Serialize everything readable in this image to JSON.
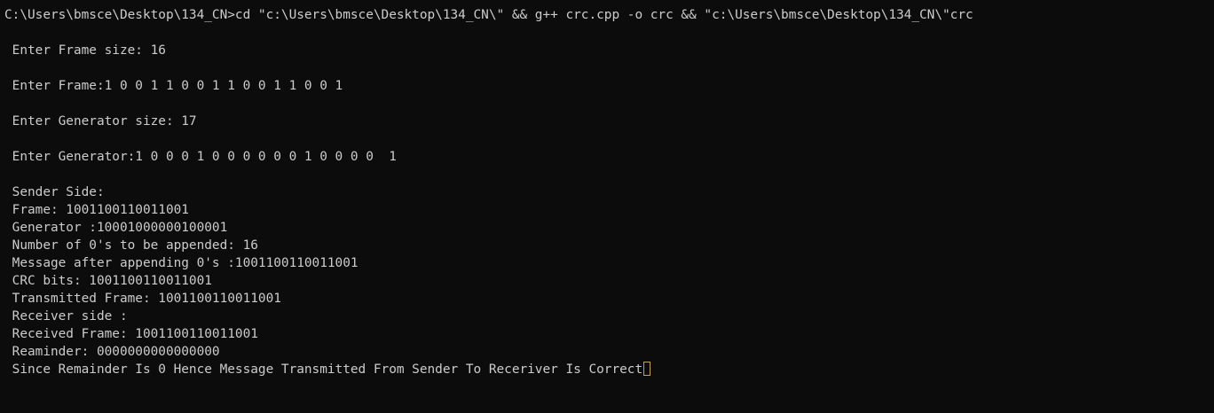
{
  "terminal": {
    "command_line": "C:\\Users\\bmsce\\Desktop\\134_CN>cd \"c:\\Users\\bmsce\\Desktop\\134_CN\\\" && g++ crc.cpp -o crc && \"c:\\Users\\bmsce\\Desktop\\134_CN\\\"crc",
    "frame_size_prompt": " Enter Frame size: 16",
    "frame_prompt": " Enter Frame:1 0 0 1 1 0 0 1 1 0 0 1 1 0 0 1",
    "generator_size_prompt": " Enter Generator size: 17",
    "generator_prompt": " Enter Generator:1 0 0 0 1 0 0 0 0 0 0 1 0 0 0 0  1",
    "sender_header": " Sender Side:",
    "frame_output": " Frame: 1001100110011001",
    "generator_output": " Generator :10001000000100001",
    "zeros_appended": " Number of 0's to be appended: 16",
    "message_after_append": " Message after appending 0's :1001100110011001",
    "crc_bits": " CRC bits: 1001100110011001",
    "transmitted_frame": " Transmitted Frame: 1001100110011001",
    "receiver_header": " Receiver side :",
    "received_frame": " Received Frame: 1001100110011001",
    "remainder": " Reaminder: 0000000000000000",
    "conclusion": " Since Remainder Is 0 Hence Message Transmitted From Sender To Receriver Is Correct"
  },
  "colors": {
    "background": "#0c0c0c",
    "text": "#cccccc",
    "cursor_outline": "#c8a04a"
  }
}
